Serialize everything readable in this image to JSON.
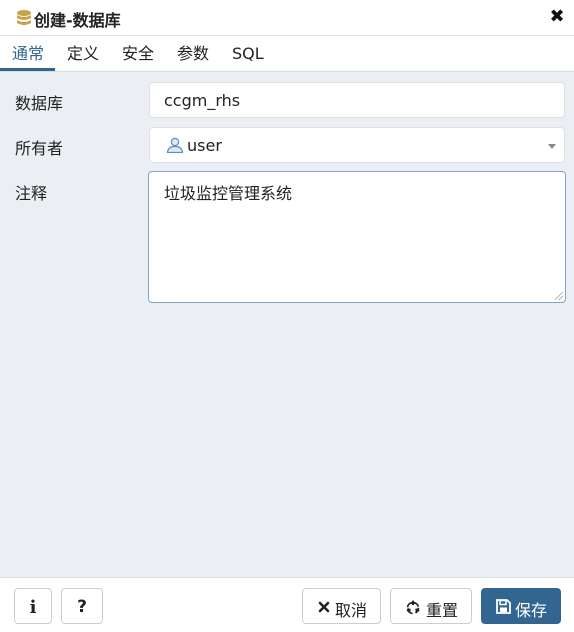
{
  "dialog": {
    "title": "创建-数据库",
    "close_symbol": "✖"
  },
  "tabs": [
    {
      "label": "通常",
      "active": true
    },
    {
      "label": "定义",
      "active": false
    },
    {
      "label": "安全",
      "active": false
    },
    {
      "label": "参数",
      "active": false
    },
    {
      "label": "SQL",
      "active": false
    }
  ],
  "form": {
    "database": {
      "label": "数据库",
      "value": "ccgm_rhs"
    },
    "owner": {
      "label": "所有者",
      "value": "user",
      "icon": "user-icon"
    },
    "comment": {
      "label": "注释",
      "value": "垃圾监控管理系统"
    }
  },
  "footer": {
    "info_symbol": "i",
    "help_symbol": "?",
    "cancel_label": "取消",
    "cancel_icon": "times-icon",
    "reset_label": "重置",
    "reset_icon": "recycle-icon",
    "save_label": "保存",
    "save_icon": "floppy-icon"
  },
  "colors": {
    "accent": "#326690",
    "content_bg": "#ebeef3",
    "title_icon": "#c8a24a"
  }
}
